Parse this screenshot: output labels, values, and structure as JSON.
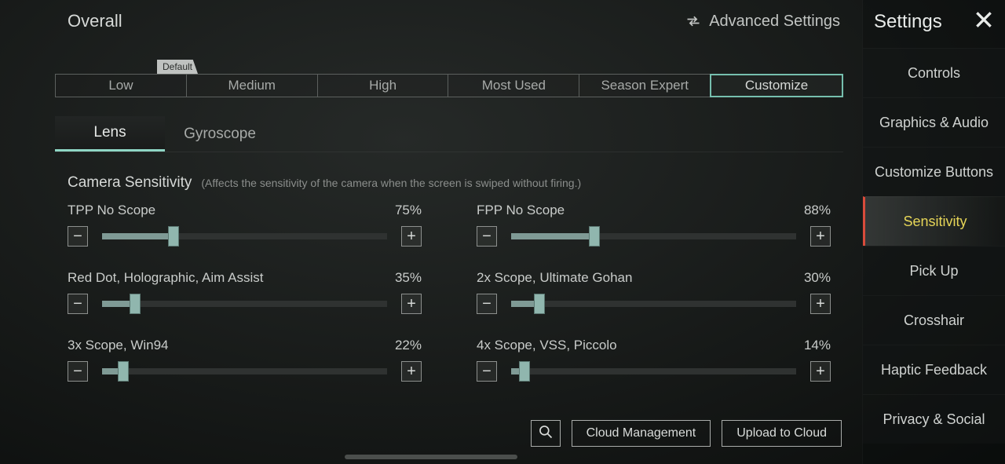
{
  "header": {
    "page_title": "Overall",
    "advanced_settings": "Advanced Settings"
  },
  "presets": {
    "default_tag": "Default",
    "tabs": [
      "Low",
      "Medium",
      "High",
      "Most Used",
      "Season Expert",
      "Customize"
    ],
    "active_index": 5,
    "default_index": 1
  },
  "sub_tabs": {
    "items": [
      "Lens",
      "Gyroscope"
    ],
    "active_index": 0
  },
  "section": {
    "title": "Camera Sensitivity",
    "note": "(Affects the sensitivity of the camera when the screen is swiped without firing.)"
  },
  "sliders": [
    {
      "label": "TPP No Scope",
      "value": 75,
      "display": "75%"
    },
    {
      "label": "FPP No Scope",
      "value": 88,
      "display": "88%"
    },
    {
      "label": "Red Dot, Holographic, Aim Assist",
      "value": 35,
      "display": "35%"
    },
    {
      "label": "2x Scope, Ultimate Gohan",
      "value": 30,
      "display": "30%"
    },
    {
      "label": "3x Scope, Win94",
      "value": 22,
      "display": "22%"
    },
    {
      "label": "4x Scope, VSS, Piccolo",
      "value": 14,
      "display": "14%"
    }
  ],
  "actions": {
    "cloud_management": "Cloud Management",
    "upload_to_cloud": "Upload to Cloud"
  },
  "sidebar": {
    "title": "Settings",
    "items": [
      "Controls",
      "Graphics & Audio",
      "Customize Buttons",
      "Sensitivity",
      "Pick Up",
      "Crosshair",
      "Haptic Feedback",
      "Privacy & Social"
    ],
    "active_index": 3
  },
  "glyphs": {
    "minus": "−",
    "plus": "+"
  }
}
